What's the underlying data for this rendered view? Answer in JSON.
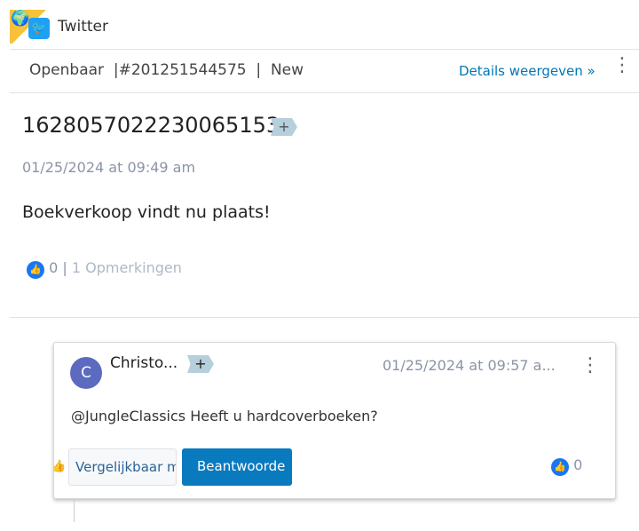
{
  "header": {
    "channel": "Twitter"
  },
  "meta": {
    "visibility": "Openbaar",
    "ticket": "#201251544575",
    "status": "New",
    "details_link": "Details weergeven"
  },
  "post": {
    "id": "1628057022230065153",
    "tag_add": "+",
    "timestamp": "01/25/2024 at 09:49 am",
    "text": "Boekverkoop vindt nu plaats!",
    "likes": "0",
    "comments": "1 Opmerkingen"
  },
  "comment": {
    "avatar_initial": "C",
    "author": "Christo...",
    "tag_add": "+",
    "timestamp": "01/25/2024 at 09:57 a...",
    "text": "@JungleClassics Heeft u hardcoverboeken?",
    "similar_button": "Vergelijkbaar m",
    "reply_button": "Beantwoorde",
    "likes": "0"
  },
  "colors": {
    "accent": "#0077b6",
    "reply_bg": "#0a7abf",
    "corner": "#f7c23a",
    "twitter": "#1da1f2",
    "avatar": "#5c6bc0"
  }
}
